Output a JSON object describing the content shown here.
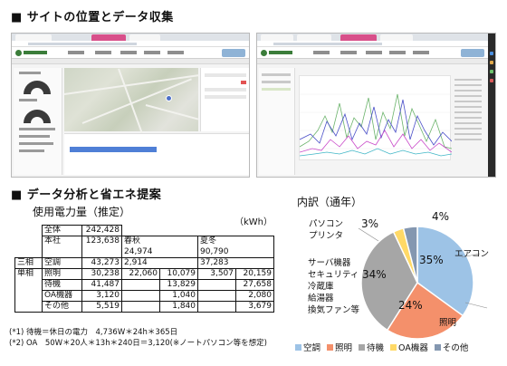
{
  "headings": {
    "site_section": "■ サイトの位置とデータ収集",
    "analysis_section": "■ データ分析と省エネ提案"
  },
  "screenshots": {
    "left_brand": "GREEN WISE",
    "right_brand": "GREEN WISE"
  },
  "usage_table": {
    "title": "使用電力量（推定）",
    "unit": "（kWh）",
    "rows": {
      "total": {
        "label": "全体",
        "value": "242,428"
      },
      "main": {
        "label": "本社",
        "value": "123,638",
        "spring_label": "春秋",
        "spring_value": "24,974",
        "summer_label": "夏冬",
        "summer_value": "90,790"
      },
      "aircon": {
        "group": "三相",
        "label": "空調",
        "value": "43,273",
        "c1": "2,914",
        "c2": "37,283"
      },
      "lighting": {
        "group": "単相",
        "label": "照明",
        "value": "30,238",
        "c1": "22,060",
        "c2": "10,079",
        "c3": "3,507",
        "c4": "20,159"
      },
      "standby": {
        "label": "待機",
        "value": "41,487",
        "c2": "13,829",
        "c4": "27,658"
      },
      "oa": {
        "label": "OA機器",
        "value": "3,120",
        "c2": "1,040",
        "c4": "2,080"
      },
      "other": {
        "label": "その他",
        "value": "5,519",
        "c2": "1,840",
        "c4": "3,679"
      }
    },
    "notes": [
      "(*1) 待機＝休日の電力　4,736W＊24h＊365日",
      "(*2) OA　50W＊20人＊13h＊240日＝3,120(※ノートパソコン等を想定)"
    ]
  },
  "chart_data": {
    "type": "pie",
    "title": "内訳（通年）",
    "slices": [
      {
        "label": "空調",
        "outside_label": "エアコン",
        "value": 35,
        "color": "#9dc3e6"
      },
      {
        "label": "照明",
        "outside_label": "照明",
        "value": 24,
        "color": "#f4906b"
      },
      {
        "label": "待機",
        "outside_label": "サーバ機器\nセキュリティ\n冷蔵庫\n給湯器\n換気ファン等",
        "value": 34,
        "color": "#a6a6a6"
      },
      {
        "label": "OA機器",
        "outside_label": "パソコン\nプリンタ",
        "value": 3,
        "color": "#ffd966"
      },
      {
        "label": "その他",
        "outside_label": "",
        "value": 4,
        "color": "#8497b0"
      }
    ],
    "value_labels": [
      "35%",
      "24%",
      "34%",
      "3%",
      "4%"
    ],
    "legend": [
      "空調",
      "照明",
      "待機",
      "OA機器",
      "その他"
    ],
    "legend_position": "bottom"
  }
}
